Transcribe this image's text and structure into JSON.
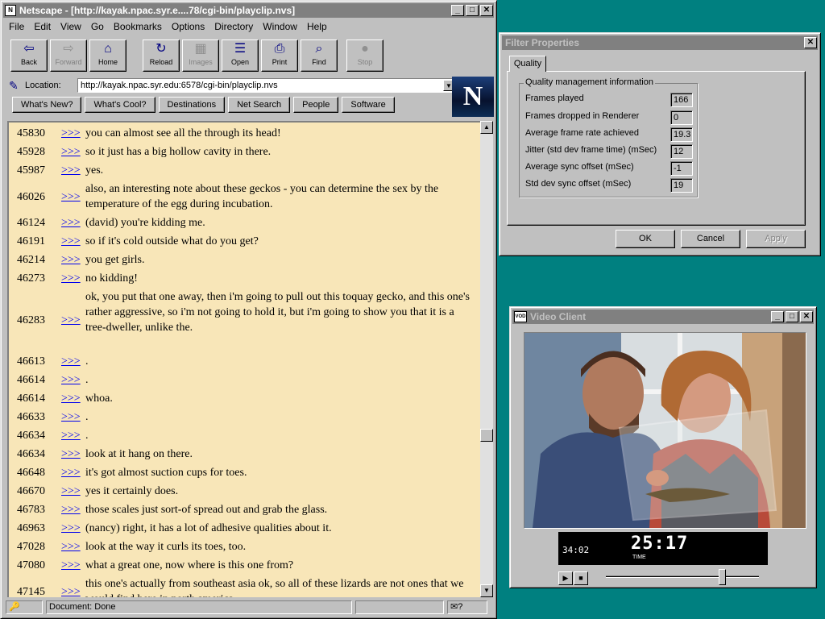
{
  "netscape": {
    "title": "Netscape - [http://kayak.npac.syr.e....78/cgi-bin/playclip.nvs]",
    "menu": [
      "File",
      "Edit",
      "View",
      "Go",
      "Bookmarks",
      "Options",
      "Directory",
      "Window",
      "Help"
    ],
    "toolbar": [
      {
        "label": "Back",
        "icon": "back-arrow-icon",
        "enabled": true
      },
      {
        "label": "Forward",
        "icon": "forward-arrow-icon",
        "enabled": false
      },
      {
        "label": "Home",
        "icon": "home-icon",
        "enabled": true
      },
      {
        "label": "Reload",
        "icon": "reload-icon",
        "enabled": true
      },
      {
        "label": "Images",
        "icon": "images-icon",
        "enabled": false
      },
      {
        "label": "Open",
        "icon": "open-icon",
        "enabled": true
      },
      {
        "label": "Print",
        "icon": "print-icon",
        "enabled": true
      },
      {
        "label": "Find",
        "icon": "find-icon",
        "enabled": true
      },
      {
        "label": "Stop",
        "icon": "stop-icon",
        "enabled": false
      }
    ],
    "location_label": "Location:",
    "location_value": "http://kayak.npac.syr.edu:6578/cgi-bin/playclip.nvs",
    "directory_buttons": [
      "What's New?",
      "What's Cool?",
      "Destinations",
      "Net Search",
      "People",
      "Software"
    ],
    "logo_letter": "N",
    "link_text": ">>>",
    "transcript": [
      {
        "t": "45830",
        "text": "you can almost see all the through its head!"
      },
      {
        "t": "45928",
        "text": "so it just has a big hollow cavity in there."
      },
      {
        "t": "45987",
        "text": "yes."
      },
      {
        "t": "46026",
        "text": "also, an interesting note about these geckos - you can determine the sex by the temperature of the egg during incubation."
      },
      {
        "t": "46124",
        "text": "(david) you're kidding me."
      },
      {
        "t": "46191",
        "text": "so if it's cold outside what do you get?"
      },
      {
        "t": "46214",
        "text": "you get girls."
      },
      {
        "t": "46273",
        "text": "no kidding!"
      },
      {
        "t": "46283",
        "text": "ok, you put that one away, then i'm going to pull out this toquay gecko, and this one's rather aggressive, so i'm not going to hold it, but i'm going to show you that it is a tree-dweller, unlike the."
      },
      {
        "t": "46613",
        "text": "."
      },
      {
        "t": "46614",
        "text": "."
      },
      {
        "t": "46614",
        "text": "whoa."
      },
      {
        "t": "46633",
        "text": "."
      },
      {
        "t": "46634",
        "text": "."
      },
      {
        "t": "46634",
        "text": "look at it hang on there."
      },
      {
        "t": "46648",
        "text": "it's got almost suction cups for toes."
      },
      {
        "t": "46670",
        "text": "yes it certainly does."
      },
      {
        "t": "46783",
        "text": "those scales just sort-of spread out and grab the glass."
      },
      {
        "t": "46963",
        "text": "(nancy) right, it has a lot of adhesive qualities about it."
      },
      {
        "t": "47028",
        "text": "look at the way it curls its toes, too."
      },
      {
        "t": "47080",
        "text": "what a great one, now where is this one from?"
      },
      {
        "t": "47145",
        "text": "this one's actually from southeast asia ok, so all of these lizards are not ones that we would find here in north america."
      }
    ],
    "status_text": "Document: Done"
  },
  "filter": {
    "title": "Filter Properties",
    "tab": "Quality",
    "group_label": "Quality management information",
    "rows": [
      {
        "label": "Frames played",
        "value": "166"
      },
      {
        "label": "Frames dropped in Renderer",
        "value": "0"
      },
      {
        "label": "Average frame rate achieved",
        "value": "19.3"
      },
      {
        "label": "Jitter (std dev frame time) (mSec)",
        "value": "12"
      },
      {
        "label": "Average sync offset (mSec)",
        "value": "-1"
      },
      {
        "label": "Std dev sync offset (mSec)",
        "value": "19"
      }
    ],
    "ok": "OK",
    "cancel": "Cancel",
    "apply": "Apply"
  },
  "video": {
    "title": "Video Client",
    "icon_text": "VOD",
    "elapsed": "34:02",
    "time": "25:17",
    "time_label": "TIME",
    "position_fraction": 0.76,
    "colors": {
      "lcd": "#000000"
    }
  }
}
